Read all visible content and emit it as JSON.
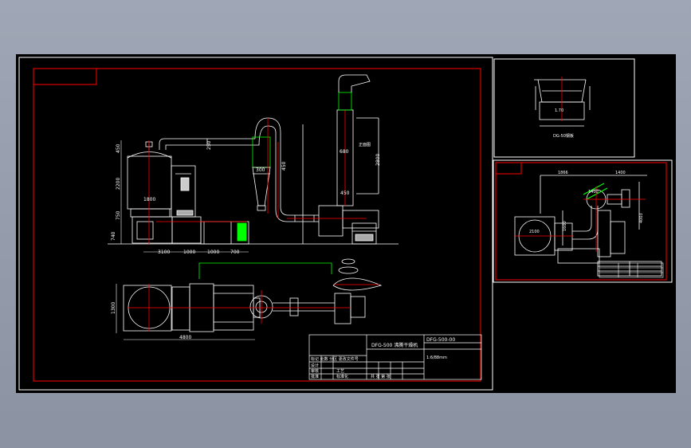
{
  "colors": {
    "background": "#000000",
    "frame_red": "#ff0000",
    "lines_white": "#ffffff",
    "accent_green": "#00ff00",
    "leader_cyan": "#00ffff",
    "page_bg": "#9ca4b3"
  },
  "elevation": {
    "dims_left": [
      "450",
      "2200",
      "750",
      "740"
    ],
    "dims_top": [
      "250",
      "300",
      "450",
      "680",
      "450",
      "2800"
    ],
    "dims_bottom": [
      "3100",
      "1000",
      "1000",
      "700"
    ],
    "dim_1800": "1800",
    "label_right": "正面图"
  },
  "plan": {
    "dim_left": "1300",
    "dim_bottom": "4800"
  },
  "detail_top": {
    "dim": "1.70",
    "label": "DG-50钢板"
  },
  "detail_side": {
    "dims": [
      "1866",
      "1400",
      "4003",
      "1600",
      "1400",
      "2100"
    ]
  },
  "title_block": {
    "title": "DFG-500 沸腾干燥机",
    "drawing_no": "DFG-500-00",
    "scale_row": "1:6/88mm",
    "rows": [
      "标记 处数 分区 更改文件号",
      "设计",
      "审核",
      "工艺",
      "批准",
      "标准化",
      "共 张 第 张"
    ]
  }
}
